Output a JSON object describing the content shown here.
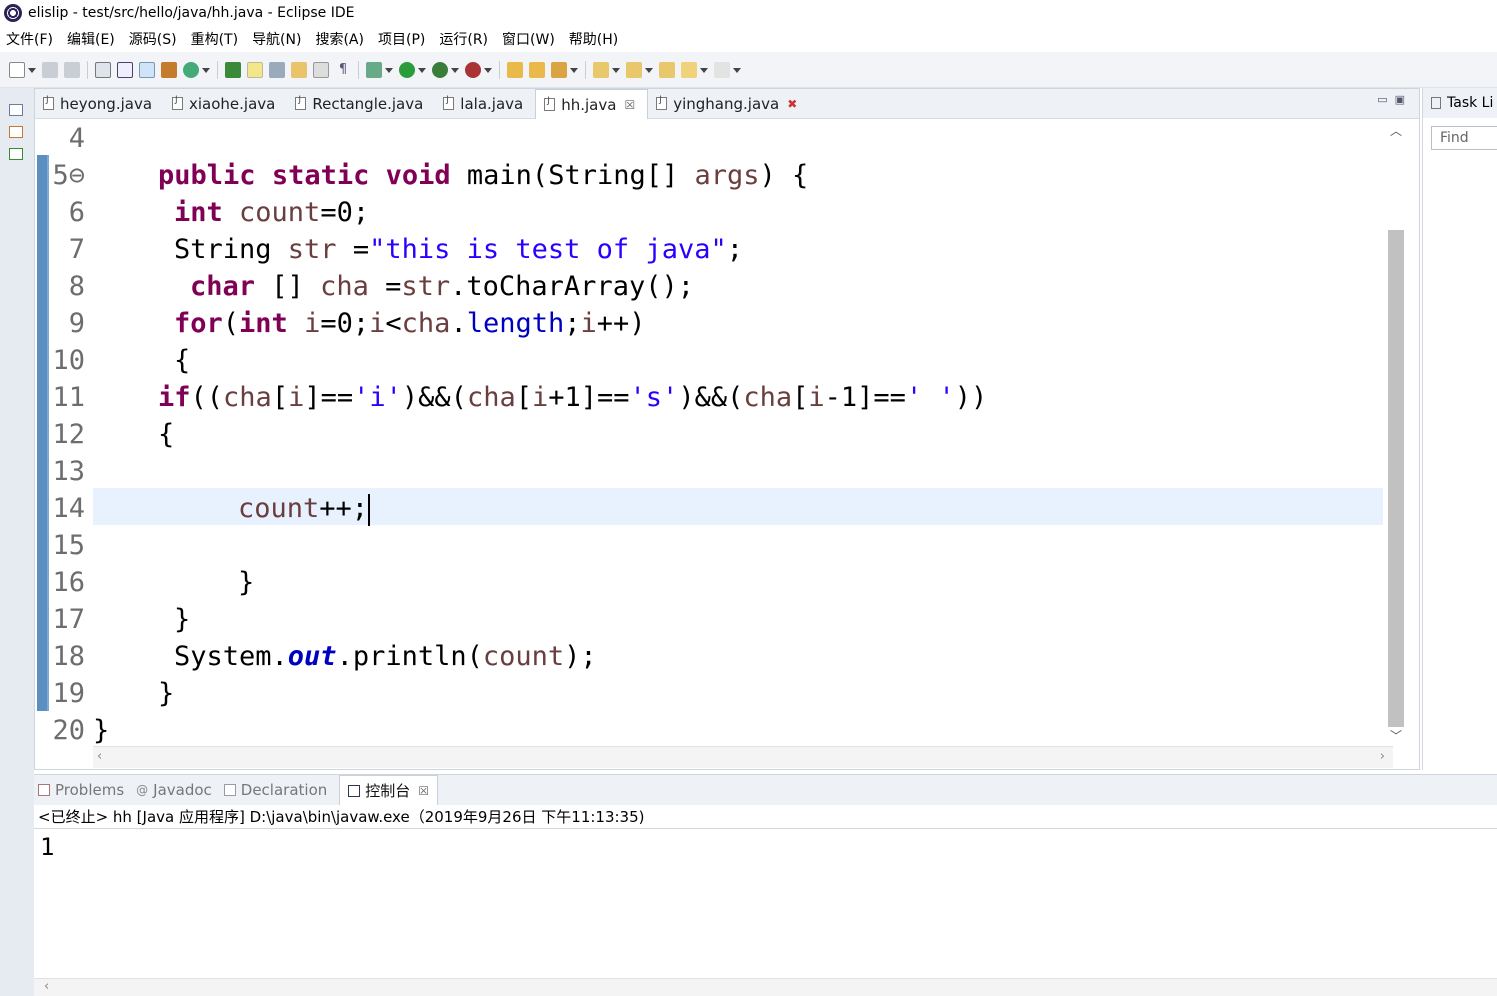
{
  "window": {
    "title": "elislip - test/src/hello/java/hh.java - Eclipse IDE"
  },
  "menu": [
    "文件(F)",
    "编辑(E)",
    "源码(S)",
    "重构(T)",
    "导航(N)",
    "搜索(A)",
    "项目(P)",
    "运行(R)",
    "窗口(W)",
    "帮助(H)"
  ],
  "toolbar_icons": [
    "new-icon",
    "save-icon",
    "save-all-icon",
    "terminal-icon",
    "console-icon",
    "pointer-icon",
    "build-icon",
    "refresh-icon",
    "debug-config-icon",
    "toggle-icon",
    "mark-icon",
    "open-type-icon",
    "search-icon",
    "paragraph-icon",
    "debug-icon",
    "run-icon",
    "coverage-icon",
    "external-tools-icon",
    "folder-icon",
    "open-icon",
    "pencil-icon",
    "next-annotation-icon",
    "prev-annotation-icon",
    "last-edit-icon",
    "back-icon",
    "forward-icon"
  ],
  "editor": {
    "tabs": [
      {
        "label": "heyong.java"
      },
      {
        "label": "xiaohe.java"
      },
      {
        "label": "Rectangle.java"
      },
      {
        "label": "lala.java"
      },
      {
        "label": "hh.java",
        "active": true,
        "close": "☒"
      },
      {
        "label": "yinghang.java",
        "close": "✖"
      }
    ],
    "lines": [
      {
        "n": "4"
      },
      {
        "n": "5⊖"
      },
      {
        "n": "6"
      },
      {
        "n": "7"
      },
      {
        "n": "8"
      },
      {
        "n": "9"
      },
      {
        "n": "10"
      },
      {
        "n": "11"
      },
      {
        "n": "12"
      },
      {
        "n": "13"
      },
      {
        "n": "14"
      },
      {
        "n": "15"
      },
      {
        "n": "16"
      },
      {
        "n": "17"
      },
      {
        "n": "18"
      },
      {
        "n": "19"
      },
      {
        "n": "20"
      }
    ],
    "code": {
      "l5": {
        "kw1": "public",
        "kw2": "static",
        "kw3": "void",
        "t1": " main(String[] ",
        "v1": "args",
        "t2": ") {"
      },
      "l6": {
        "kw1": "int",
        "v1": " count",
        "t1": "=0;"
      },
      "l7": {
        "t1": "String ",
        "v1": "str",
        "t2": " =",
        "s1": "\"this is test of java\"",
        "t3": ";"
      },
      "l8": {
        "kw1": "char",
        "t1": " [] ",
        "v1": "cha",
        "t2": " =",
        "v2": "str",
        "t3": ".toCharArray();"
      },
      "l9": {
        "kw1": "for",
        "t1": "(",
        "kw2": "int",
        "v1": " i",
        "t2": "=0;",
        "v2": "i",
        "t3": "<",
        "v3": "cha",
        "t4": ".",
        "f1": "length",
        "t5": ";",
        "v4": "i",
        "t6": "++)"
      },
      "l10": {
        "t1": "{"
      },
      "l11": {
        "kw1": "if",
        "t1": "((",
        "v1": "cha",
        "t2": "[",
        "v2": "i",
        "t3": "]==",
        "s1": "'i'",
        "t4": ")&&(",
        "v3": "cha",
        "t5": "[",
        "v4": "i",
        "t6": "+1]==",
        "s2": "'s'",
        "t7": ")&&(",
        "v5": "cha",
        "t8": "[",
        "v6": "i",
        "t9": "-1]==",
        "s3": "' '",
        "t10": "))"
      },
      "l12": {
        "t1": "{"
      },
      "l14": {
        "v1": "count",
        "t1": "++;"
      },
      "l16": {
        "t1": "}"
      },
      "l17": {
        "t1": "}"
      },
      "l18": {
        "t1": "System.",
        "sf1": "out",
        "t2": ".println(",
        "v1": "count",
        "t3": ");"
      },
      "l19": {
        "t1": "}"
      },
      "l20": {
        "t1": "}"
      }
    }
  },
  "right_panel": {
    "title": "Task Li",
    "find_placeholder": "Find"
  },
  "bottom": {
    "tabs": [
      {
        "label": "Problems"
      },
      {
        "label": "Javadoc"
      },
      {
        "label": "Declaration"
      },
      {
        "label": "控制台",
        "active": true,
        "close": "☒"
      }
    ],
    "console_status": "<已终止> hh [Java 应用程序] D:\\java\\bin\\javaw.exe（2019年9月26日 下午11:13:35)",
    "output": "1"
  },
  "colors": {
    "keyword": "#7f0055",
    "string": "#2a00ff",
    "variable": "#6a3e3e",
    "field": "#0000c0",
    "current_line": "#e8f2fe"
  }
}
